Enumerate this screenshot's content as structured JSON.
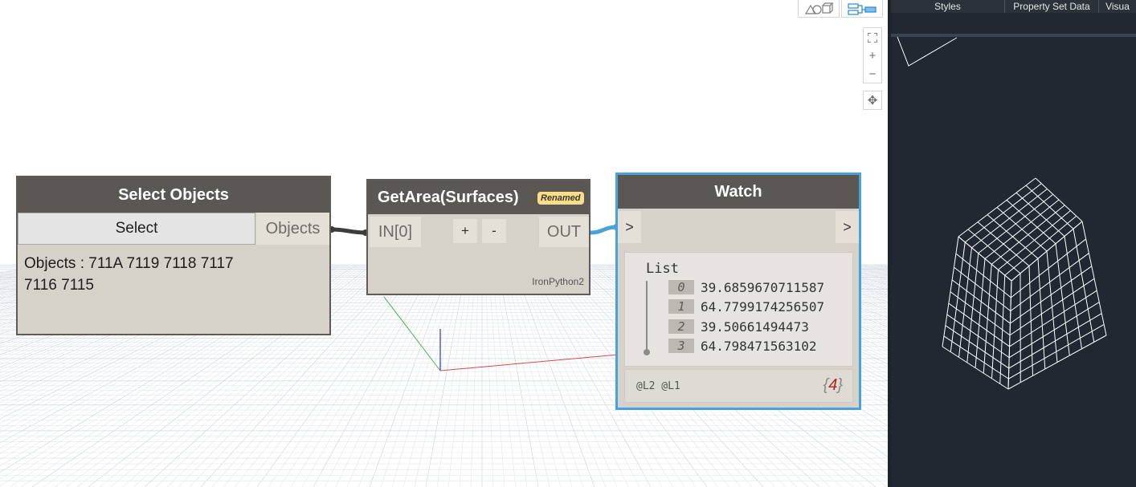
{
  "toolbar": {
    "geometry_toggle_icon": "geometry-view-icon",
    "graph_toggle_icon": "graph-view-icon",
    "zoom_to_fit_glyph": "⛶",
    "zoom_in_glyph": "+",
    "zoom_out_glyph": "−",
    "pan_glyph": "✥"
  },
  "nodes": {
    "select_objects": {
      "title": "Select Objects",
      "button_label": "Select",
      "output_port": "Objects",
      "summary_line1": "Objects : 711A 7119 7118 7117",
      "summary_line2": "7116 7115"
    },
    "get_area": {
      "title": "GetArea(Surfaces)",
      "badge": "Renamed",
      "input_port": "IN[0]",
      "add_label": "+",
      "remove_label": "-",
      "output_port": "OUT",
      "engine": "IronPython2"
    },
    "watch": {
      "title": "Watch",
      "in_port": ">",
      "out_port": ">",
      "list_label": "List",
      "items": [
        {
          "index": "0",
          "value": "39.6859670711587"
        },
        {
          "index": "1",
          "value": "64.7799174256507"
        },
        {
          "index": "2",
          "value": "39.50661494473"
        },
        {
          "index": "3",
          "value": "64.798471563102"
        }
      ],
      "levels": "@L2 @L1",
      "count_open": "{",
      "count": "4",
      "count_close": "}"
    }
  },
  "connectors": {
    "select_to_getarea_color": "#3c3c3c",
    "getarea_to_watch_color": "#4aa2d9"
  },
  "cad": {
    "tabs": [
      "Styles",
      "Property Set Data",
      "Visua"
    ]
  }
}
